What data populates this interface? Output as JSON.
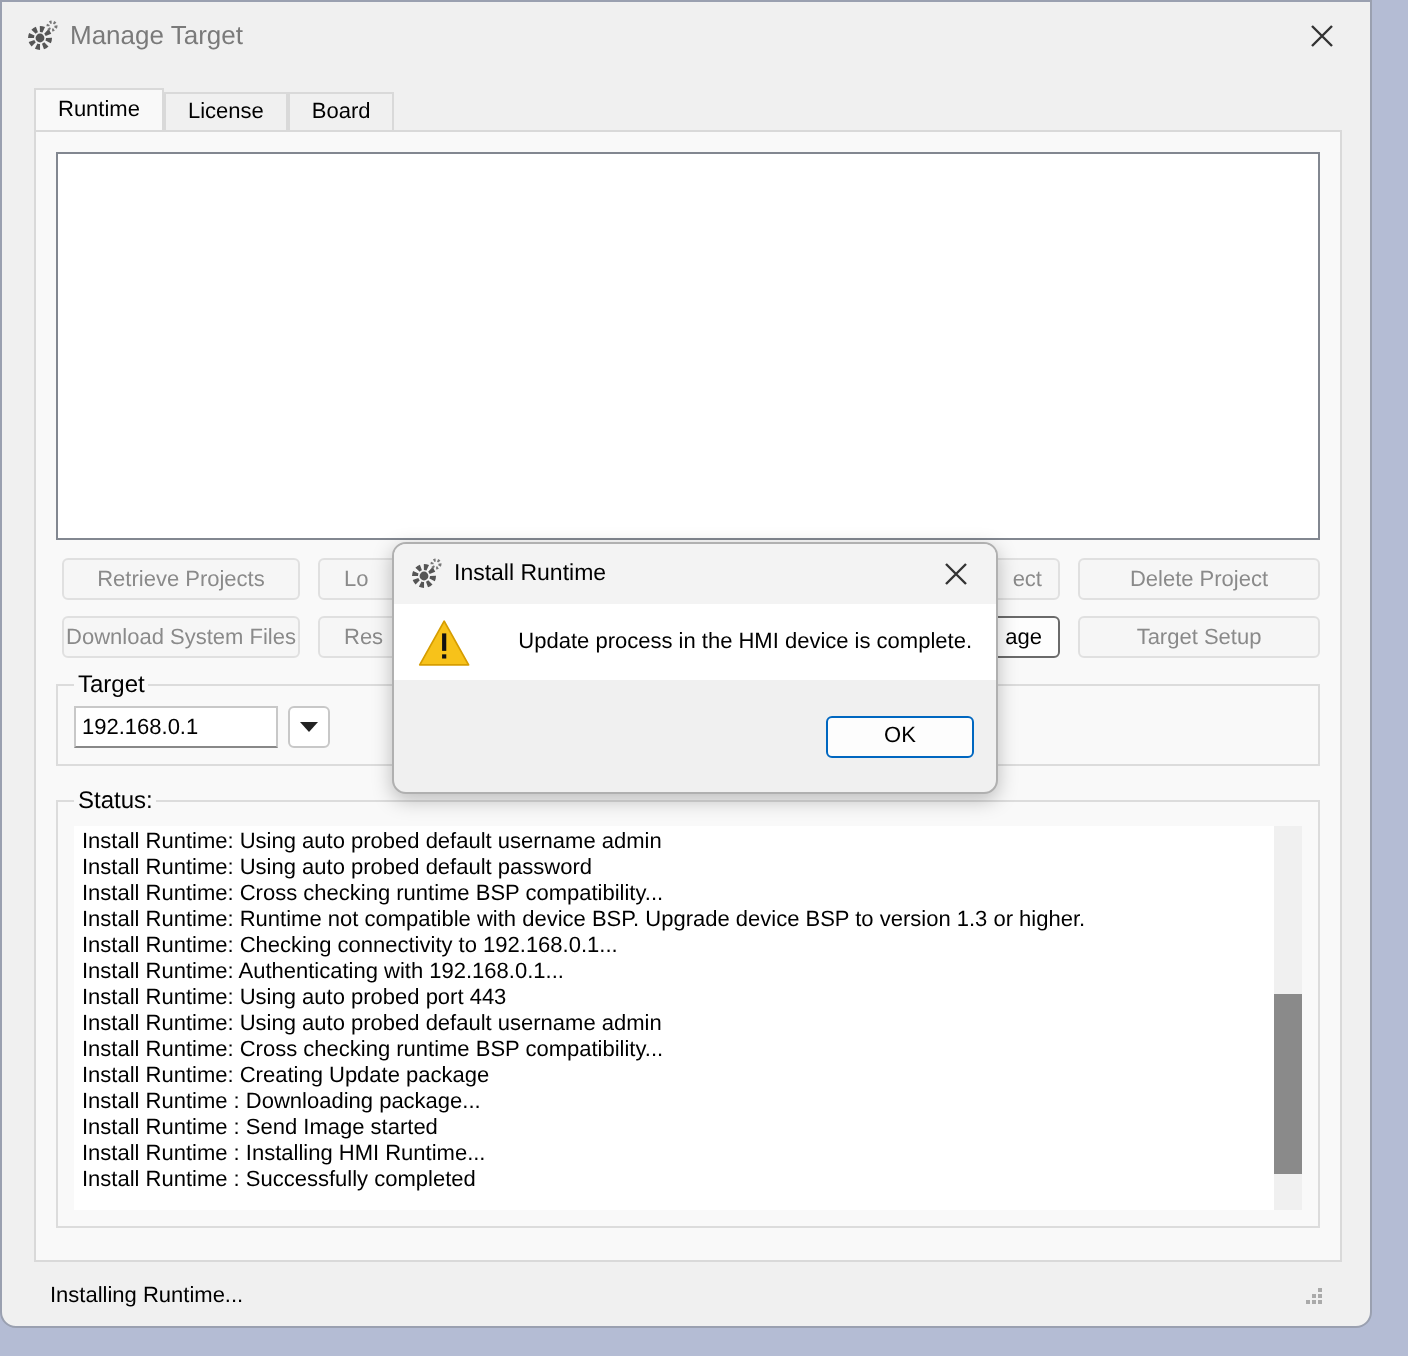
{
  "window": {
    "title": "Manage Target"
  },
  "tabs": [
    {
      "label": "Runtime",
      "selected": true
    },
    {
      "label": "License",
      "selected": false
    },
    {
      "label": "Board",
      "selected": false
    }
  ],
  "buttons": [
    {
      "label": "Retrieve Projects",
      "disabled": true
    },
    {
      "label": "Lo",
      "disabled": true
    },
    {
      "label": "ect",
      "disabled": true
    },
    {
      "label": "Delete Project",
      "disabled": true
    },
    {
      "label": "Download System Files",
      "disabled": true
    },
    {
      "label": "Res",
      "disabled": true
    },
    {
      "label": "age",
      "disabled": false
    },
    {
      "label": "Target Setup",
      "disabled": true
    }
  ],
  "target": {
    "label": "Target",
    "value": "192.168.0.1"
  },
  "status": {
    "label": "Status:",
    "lines": [
      "Install Runtime: Using auto probed default username admin",
      "Install Runtime: Using auto probed default password",
      "Install Runtime: Cross checking runtime BSP compatibility...",
      "Install Runtime: Runtime not compatible with device BSP. Upgrade device BSP to version 1.3 or higher.",
      "Install Runtime: Checking connectivity to 192.168.0.1...",
      "Install Runtime: Authenticating with 192.168.0.1...",
      "Install Runtime: Using auto probed port 443",
      "Install Runtime: Using auto probed default username admin",
      "Install Runtime: Cross checking runtime BSP compatibility...",
      "Install Runtime: Creating Update package",
      "Install Runtime : Downloading package...",
      "Install Runtime : Send Image started",
      "Install Runtime : Installing HMI Runtime...",
      "Install Runtime : Successfully completed"
    ]
  },
  "status_bar": "Installing Runtime...",
  "dialog": {
    "title": "Install Runtime",
    "message": "Update process in the HMI device is complete.",
    "button": "OK"
  }
}
